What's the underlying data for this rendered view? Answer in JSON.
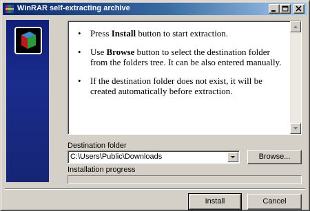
{
  "window": {
    "title": "WinRAR self-extracting archive"
  },
  "instructions": [
    {
      "before": "Press ",
      "bold": "Install",
      "after": " button to start extraction."
    },
    {
      "before": "Use ",
      "bold": "Browse",
      "after": " button to select the destination folder from the folders tree. It can be also entered manually."
    },
    {
      "before": "If the destination folder does not exist, it will be created automatically before extraction.",
      "bold": "",
      "after": ""
    }
  ],
  "destination": {
    "label": "Destination folder",
    "value": "C:\\Users\\Public\\Downloads",
    "browse_label": "Browse..."
  },
  "progress": {
    "label": "Installation progress",
    "value": 0
  },
  "buttons": {
    "install_label": "Install",
    "cancel_label": "Cancel"
  },
  "colors": {
    "title_start": "#0a246a",
    "sidebar": "#1a2c8c"
  },
  "icons": [
    "winrar-app-icon",
    "minimize-icon",
    "maximize-icon",
    "close-icon",
    "scroll-up-icon",
    "scroll-down-icon",
    "dropdown-arrow-icon",
    "winrar-logo-icon"
  ]
}
